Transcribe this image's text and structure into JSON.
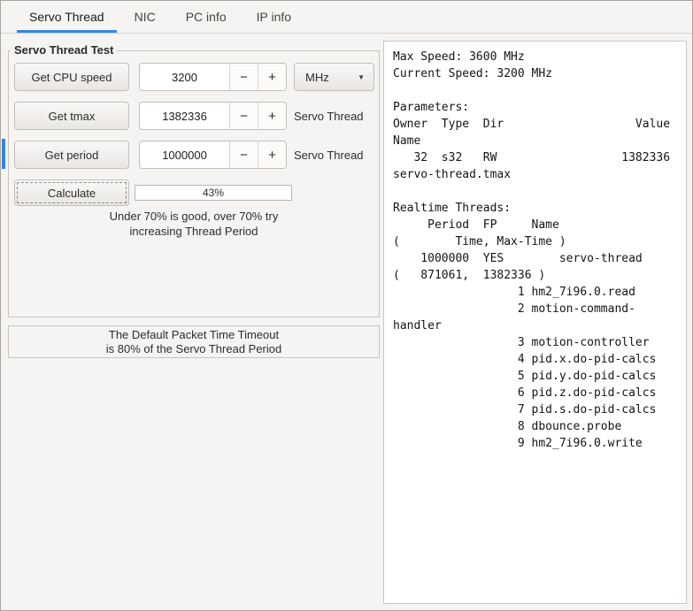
{
  "tabs": {
    "servo_thread": "Servo Thread",
    "nic": "NIC",
    "pc_info": "PC info",
    "ip_info": "IP info"
  },
  "frame": {
    "title": "Servo Thread Test",
    "cpu_row": {
      "button": "Get CPU speed",
      "value": "3200",
      "unit": "MHz"
    },
    "tmax_row": {
      "button": "Get tmax",
      "value": "1382336",
      "label": "Servo Thread"
    },
    "period_row": {
      "button": "Get period",
      "value": "1000000",
      "label": "Servo Thread"
    },
    "calc_row": {
      "button": "Calculate",
      "progress_text": "43%",
      "progress_percent": 43
    },
    "hint_line1": "Under 70% is good, over 70% try",
    "hint_line2": "increasing Thread Period"
  },
  "glyphs": {
    "minus": "−",
    "plus": "+",
    "dropdown_arrow": "▼"
  },
  "note": {
    "line1": "The Default Packet Time Timeout",
    "line2": "is 80% of the Servo Thread Period"
  },
  "output": {
    "text": "Max Speed: 3600 MHz\nCurrent Speed: 3200 MHz\n\nParameters:\nOwner  Type  Dir                   Value\nName\n   32  s32   RW                  1382336\nservo-thread.tmax\n\nRealtime Threads:\n     Period  FP     Name\n(        Time, Max-Time )\n    1000000  YES        servo-thread\n(   871061,  1382336 )\n                  1 hm2_7i96.0.read\n                  2 motion-command-\nhandler\n                  3 motion-controller\n                  4 pid.x.do-pid-calcs\n                  5 pid.y.do-pid-calcs\n                  6 pid.z.do-pid-calcs\n                  7 pid.s.do-pid-calcs\n                  8 dbounce.probe\n                  9 hm2_7i96.0.write"
  },
  "colors": {
    "accent": "#3584e4"
  }
}
